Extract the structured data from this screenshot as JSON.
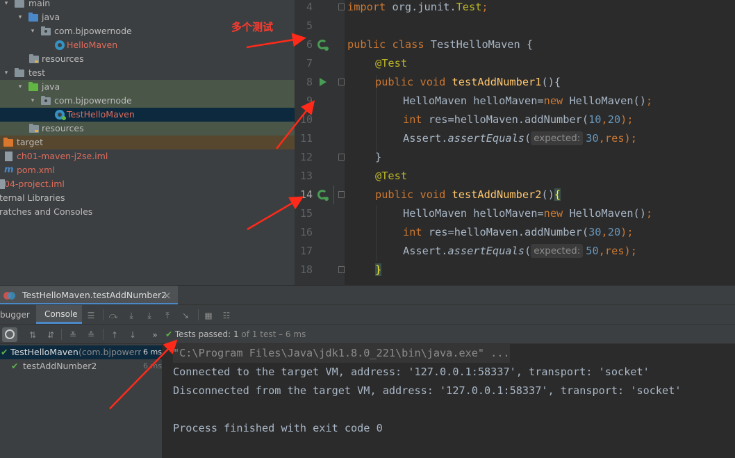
{
  "project_tree": [
    {
      "label": "main",
      "indent": 0,
      "arrow": "▾",
      "icon": "folder-grey",
      "style": ""
    },
    {
      "label": "java",
      "indent": 1,
      "arrow": "▾",
      "icon": "folder-blue",
      "style": ""
    },
    {
      "label": "com.bjpowernode",
      "indent": 2,
      "arrow": "▾",
      "icon": "package",
      "style": ""
    },
    {
      "label": "HelloMaven",
      "indent": 3,
      "arrow": "",
      "icon": "class",
      "style": "red"
    },
    {
      "label": "resources",
      "indent": 1,
      "arrow": "",
      "icon": "resources",
      "style": ""
    },
    {
      "label": "test",
      "indent": 0,
      "arrow": "▾",
      "icon": "folder-grey",
      "style": ""
    },
    {
      "label": "java",
      "indent": 1,
      "arrow": "▾",
      "icon": "folder-green",
      "style": "hl"
    },
    {
      "label": "com.bjpowernode",
      "indent": 2,
      "arrow": "▾",
      "icon": "package",
      "style": "hl"
    },
    {
      "label": "TestHelloMaven",
      "indent": 3,
      "arrow": "",
      "icon": "test-class",
      "style": "selected"
    },
    {
      "label": "resources",
      "indent": 1,
      "arrow": "",
      "icon": "resources",
      "style": "hl"
    },
    {
      "label": "target",
      "indent": -1,
      "arrow": "",
      "icon": "folder-orange",
      "style": "orange"
    },
    {
      "label": "ch01-maven-j2se.iml",
      "indent": -1,
      "arrow": "",
      "icon": "file",
      "style": "red"
    },
    {
      "label": "pom.xml",
      "indent": -1,
      "arrow": "",
      "icon": "maven",
      "style": "red"
    },
    {
      "label": "04-project.iml",
      "indent": -1,
      "arrow": "",
      "icon": "file",
      "style": "red"
    },
    {
      "label": "ternal Libraries",
      "indent": -2,
      "arrow": "",
      "icon": "",
      "style": ""
    },
    {
      "label": "ratches and Consoles",
      "indent": -2,
      "arrow": "",
      "icon": "",
      "style": ""
    }
  ],
  "editor": {
    "line_numbers": [
      "4",
      "5",
      "6",
      "7",
      "8",
      "9",
      "10",
      "11",
      "12",
      "13",
      "14",
      "15",
      "16",
      "17",
      "18"
    ],
    "current_line": "14",
    "run_gutter_lines": [
      "6",
      "8",
      "14"
    ]
  },
  "code": {
    "l4": {
      "kw": "import",
      "rest": " org.junit.",
      "cls": "Test",
      "end": ";"
    },
    "l6": {
      "kw1": "public",
      "kw2": "class",
      "name": "TestHelloMaven",
      "end": " {"
    },
    "l7": {
      "ann": "@Test"
    },
    "l8": {
      "kw1": "public",
      "kw2": "void",
      "fn": "testAddNumber1",
      "end": "(){"
    },
    "l9": {
      "a": "HelloMaven helloMaven=",
      "kw": "new",
      "b": " HelloMaven()",
      "end": ";"
    },
    "l10": {
      "kw": "int",
      "a": " res=helloMaven.addNumber(",
      "n1": "10",
      "c": ",",
      "n2": "20",
      "end": ");"
    },
    "l11": {
      "a": "Assert.",
      "fn": "assertEquals",
      "p": "(",
      "hint": "expected:",
      "n": "30",
      "end": ",res);"
    },
    "l12": {
      "t": "}"
    },
    "l13": {
      "ann": "@Test"
    },
    "l14": {
      "kw1": "public",
      "kw2": "void",
      "fn": "testAddNumber2",
      "p": "()",
      "brace": "{"
    },
    "l15": {
      "a": "HelloMaven helloMaven=",
      "kw": "new",
      "b": " HelloMaven()",
      "end": ";"
    },
    "l16": {
      "kw": "int",
      "a": " res=helloMaven.addNumber(",
      "n1": "30",
      "c": ",",
      "n2": "20",
      "end": ");"
    },
    "l17": {
      "a": "Assert.",
      "fn": "assertEquals",
      "p": "(",
      "hint": "expected:",
      "n": "50",
      "end": ",res);"
    },
    "l18": {
      "brace": "}"
    }
  },
  "annotation": {
    "text": "多个测试",
    "color": "#ff3b30"
  },
  "run_panel": {
    "tab_title": "TestHelloMaven.testAddNumber2",
    "close": "×",
    "subtabs": [
      "bugger",
      "Console"
    ],
    "status": {
      "label": "Tests passed:",
      "count": "1",
      "rest": "of 1 test – 6 ms"
    },
    "tests": [
      {
        "name": "TestHelloMaven",
        "detail": "(com.bjpowernc",
        "time": "6 ms"
      },
      {
        "name": "testAddNumber2",
        "detail": "",
        "time": "6 ms"
      }
    ],
    "console": [
      "\"C:\\Program Files\\Java\\jdk1.8.0_221\\bin\\java.exe\" ...",
      "Connected to the target VM, address: '127.0.0.1:58337', transport: 'socket'",
      "Disconnected from the target VM, address: '127.0.0.1:58337', transport: 'socket'",
      "",
      "Process finished with exit code 0"
    ]
  },
  "colors": {
    "pass_green": "#5fb04c",
    "keyword": "#cc7832",
    "annotation": "#bbb529",
    "function": "#ffc66d",
    "number": "#6897bb"
  }
}
